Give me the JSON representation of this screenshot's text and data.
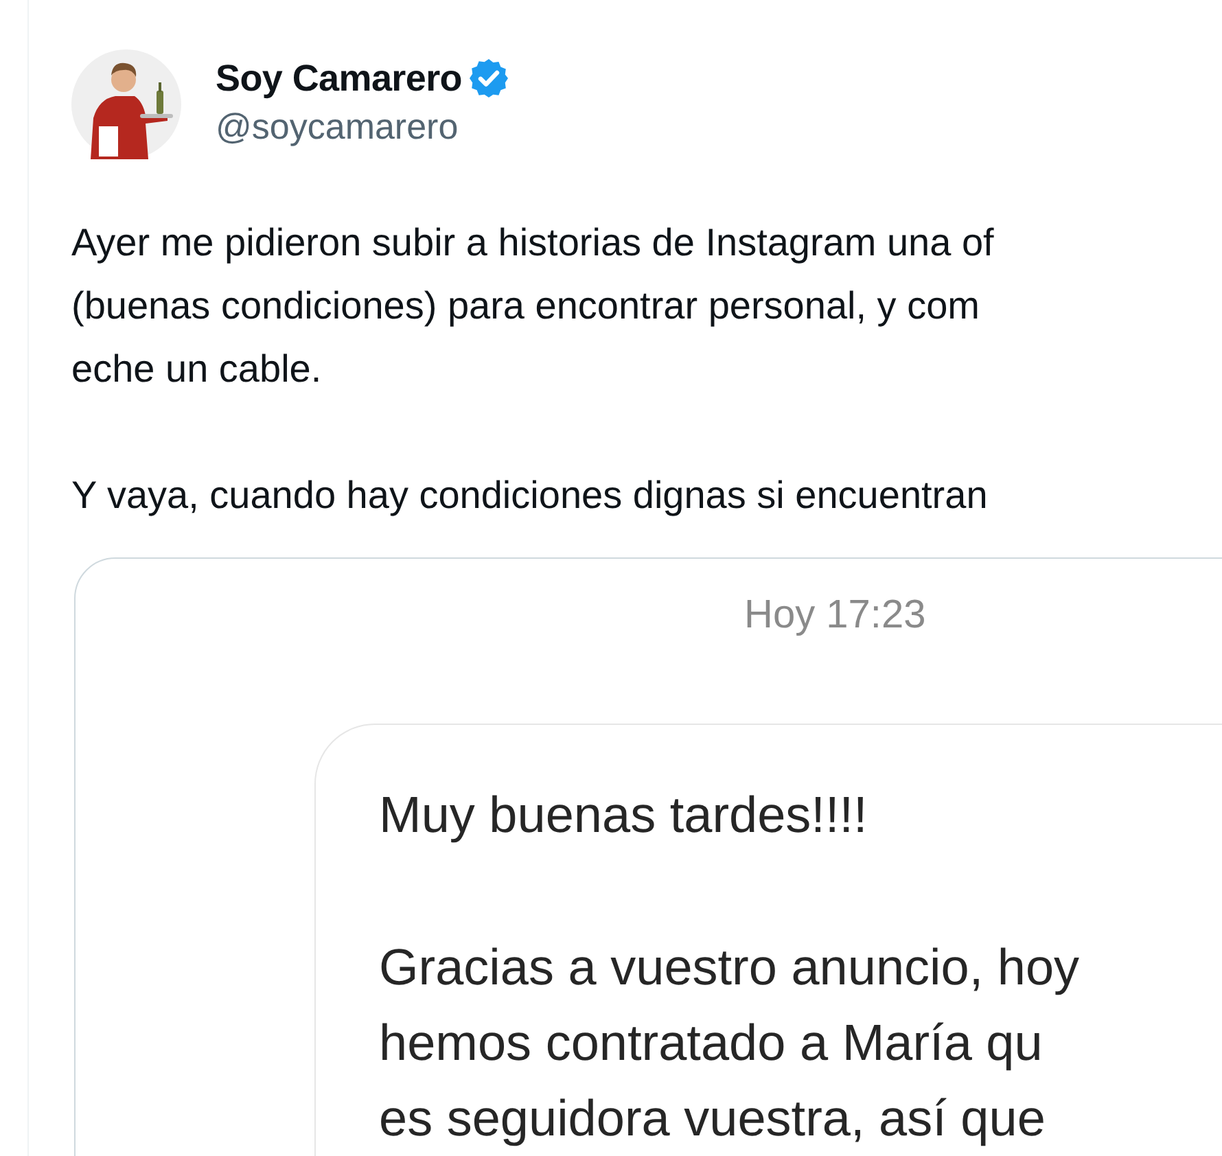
{
  "tweet": {
    "author": {
      "name": "Soy Camarero",
      "verified": true,
      "handle": "@soycamarero"
    },
    "paragraphs": [
      "Ayer me pidieron subir a historias de Instagram una of\n(buenas condiciones) para encontrar personal, y com\neche un cable.",
      "Y vaya, cuando hay condiciones dignas si encuentran"
    ],
    "attachment": {
      "timestamp": "Hoy 17:23",
      "message_paragraphs": [
        "Muy buenas tardes!!!!",
        "Gracias a vuestro anuncio, hoy\nhemos contratado a María qu\nes seguidora vuestra, así que"
      ]
    }
  }
}
